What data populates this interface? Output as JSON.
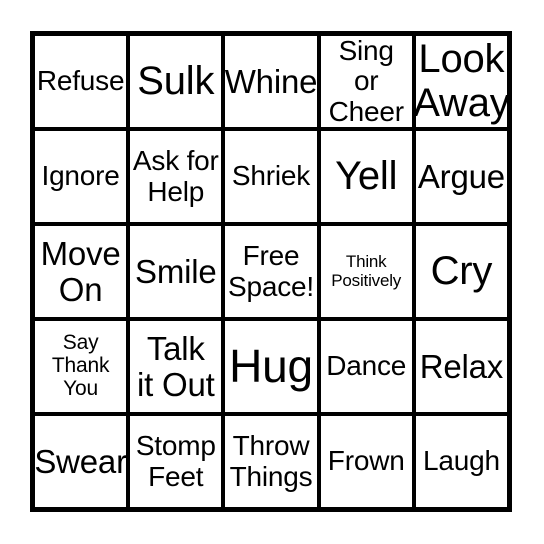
{
  "card": {
    "type": "bingo-card",
    "grid": {
      "rows": 5,
      "columns": 5
    },
    "colors": {
      "background": "#ffffff",
      "border": "#000000",
      "cell_background": "#ffffff",
      "text": "#000000"
    },
    "free_space_label": "Free Space!",
    "cells": [
      {
        "text": "Refuse",
        "size": "m",
        "row": 1,
        "col": 1
      },
      {
        "text": "Sulk",
        "size": "xl",
        "row": 1,
        "col": 2
      },
      {
        "text": "Whine",
        "size": "l",
        "row": 1,
        "col": 3
      },
      {
        "text": "Sing or\nCheer",
        "size": "m",
        "row": 1,
        "col": 4
      },
      {
        "text": "Look\nAway",
        "size": "xl",
        "row": 1,
        "col": 5
      },
      {
        "text": "Ignore",
        "size": "m",
        "row": 2,
        "col": 1
      },
      {
        "text": "Ask for\nHelp",
        "size": "m",
        "row": 2,
        "col": 2
      },
      {
        "text": "Shriek",
        "size": "m",
        "row": 2,
        "col": 3
      },
      {
        "text": "Yell",
        "size": "xl",
        "row": 2,
        "col": 4
      },
      {
        "text": "Argue",
        "size": "l",
        "row": 2,
        "col": 5
      },
      {
        "text": "Move\nOn",
        "size": "l",
        "row": 3,
        "col": 1
      },
      {
        "text": "Smile",
        "size": "l",
        "row": 3,
        "col": 2
      },
      {
        "text": "Free\nSpace!",
        "size": "m",
        "row": 3,
        "col": 3
      },
      {
        "text": "Think\nPositively",
        "size": "xxs",
        "row": 3,
        "col": 4
      },
      {
        "text": "Cry",
        "size": "xl",
        "row": 3,
        "col": 5
      },
      {
        "text": "Say\nThank\nYou",
        "size": "xs",
        "row": 4,
        "col": 1
      },
      {
        "text": "Talk\nit Out",
        "size": "l",
        "row": 4,
        "col": 2
      },
      {
        "text": "Hug",
        "size": "xxl",
        "row": 4,
        "col": 3
      },
      {
        "text": "Dance",
        "size": "m",
        "row": 4,
        "col": 4
      },
      {
        "text": "Relax",
        "size": "l",
        "row": 4,
        "col": 5
      },
      {
        "text": "Swear",
        "size": "l",
        "row": 5,
        "col": 1
      },
      {
        "text": "Stomp\nFeet",
        "size": "m",
        "row": 5,
        "col": 2
      },
      {
        "text": "Throw\nThings",
        "size": "m",
        "row": 5,
        "col": 3
      },
      {
        "text": "Frown",
        "size": "m",
        "row": 5,
        "col": 4
      },
      {
        "text": "Laugh",
        "size": "m",
        "row": 5,
        "col": 5
      }
    ]
  }
}
